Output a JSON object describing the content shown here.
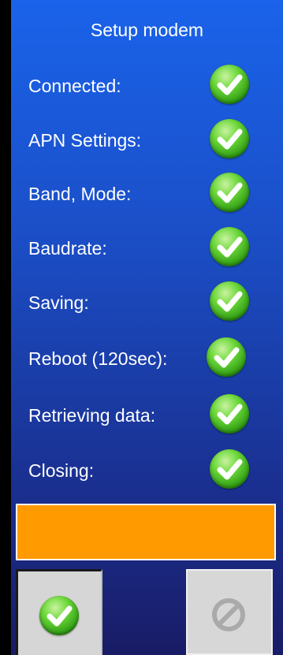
{
  "title": "Setup modem",
  "steps": [
    {
      "label": "Connected:",
      "status": "done"
    },
    {
      "label": "APN Settings:",
      "status": "done"
    },
    {
      "label": "Band, Mode:",
      "status": "done"
    },
    {
      "label": "Baudrate:",
      "status": "done"
    },
    {
      "label": "Saving:",
      "status": "done"
    },
    {
      "label": "Reboot (120sec):",
      "status": "done"
    },
    {
      "label": "Retrieving data:",
      "status": "done"
    },
    {
      "label": "Closing:",
      "status": "done"
    }
  ],
  "status_bar": {
    "color": "#ff9a00",
    "text": ""
  },
  "buttons": {
    "confirm": {
      "icon": "check-circle-icon",
      "enabled": true
    },
    "cancel": {
      "icon": "prohibited-icon",
      "enabled": false
    }
  },
  "colors": {
    "accent": "#1a63ea",
    "success": "#3cb81a",
    "warning": "#ff9a00"
  }
}
